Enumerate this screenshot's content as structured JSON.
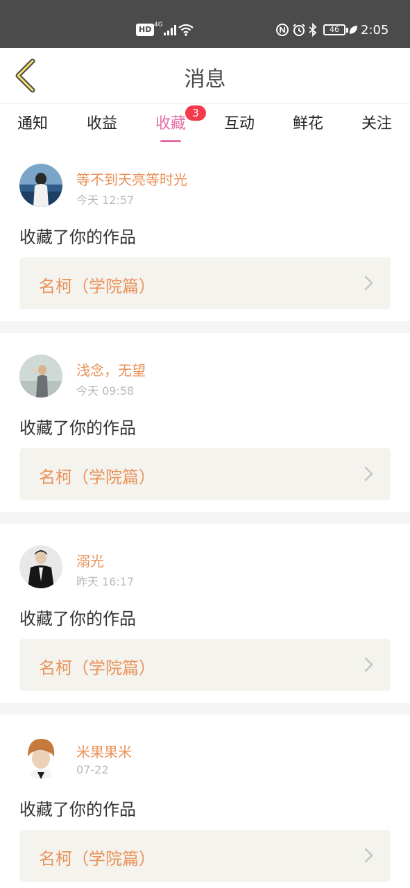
{
  "status_bar": {
    "hd": "HD",
    "network": "4G",
    "battery": "46",
    "time": "2:05"
  },
  "header": {
    "title": "消息",
    "back_icon": "chevron-left-icon"
  },
  "tabs": [
    {
      "label": "通知",
      "active": false
    },
    {
      "label": "收益",
      "active": false
    },
    {
      "label": "收藏",
      "active": true,
      "badge": "3"
    },
    {
      "label": "互动",
      "active": false
    },
    {
      "label": "鲜花",
      "active": false
    },
    {
      "label": "关注",
      "active": false
    }
  ],
  "colors": {
    "accent": "#e56fa9",
    "name": "#e9925a",
    "badge": "#f23a4a",
    "status_bar": "#4b4b4b",
    "work_box": "#f4f3ee"
  },
  "items": [
    {
      "user": "等不到天亮等时光",
      "time": "今天 12:57",
      "action": "收藏了你的作品",
      "work": "名柯（学院篇）"
    },
    {
      "user": "浅念，无望",
      "time": "今天 09:58",
      "action": "收藏了你的作品",
      "work": "名柯（学院篇）"
    },
    {
      "user": "溺光",
      "time": "昨天 16:17",
      "action": "收藏了你的作品",
      "work": "名柯（学院篇）"
    },
    {
      "user": "米果果米",
      "time": "07-22",
      "action": "收藏了你的作品",
      "work": "名柯（学院篇）"
    }
  ]
}
